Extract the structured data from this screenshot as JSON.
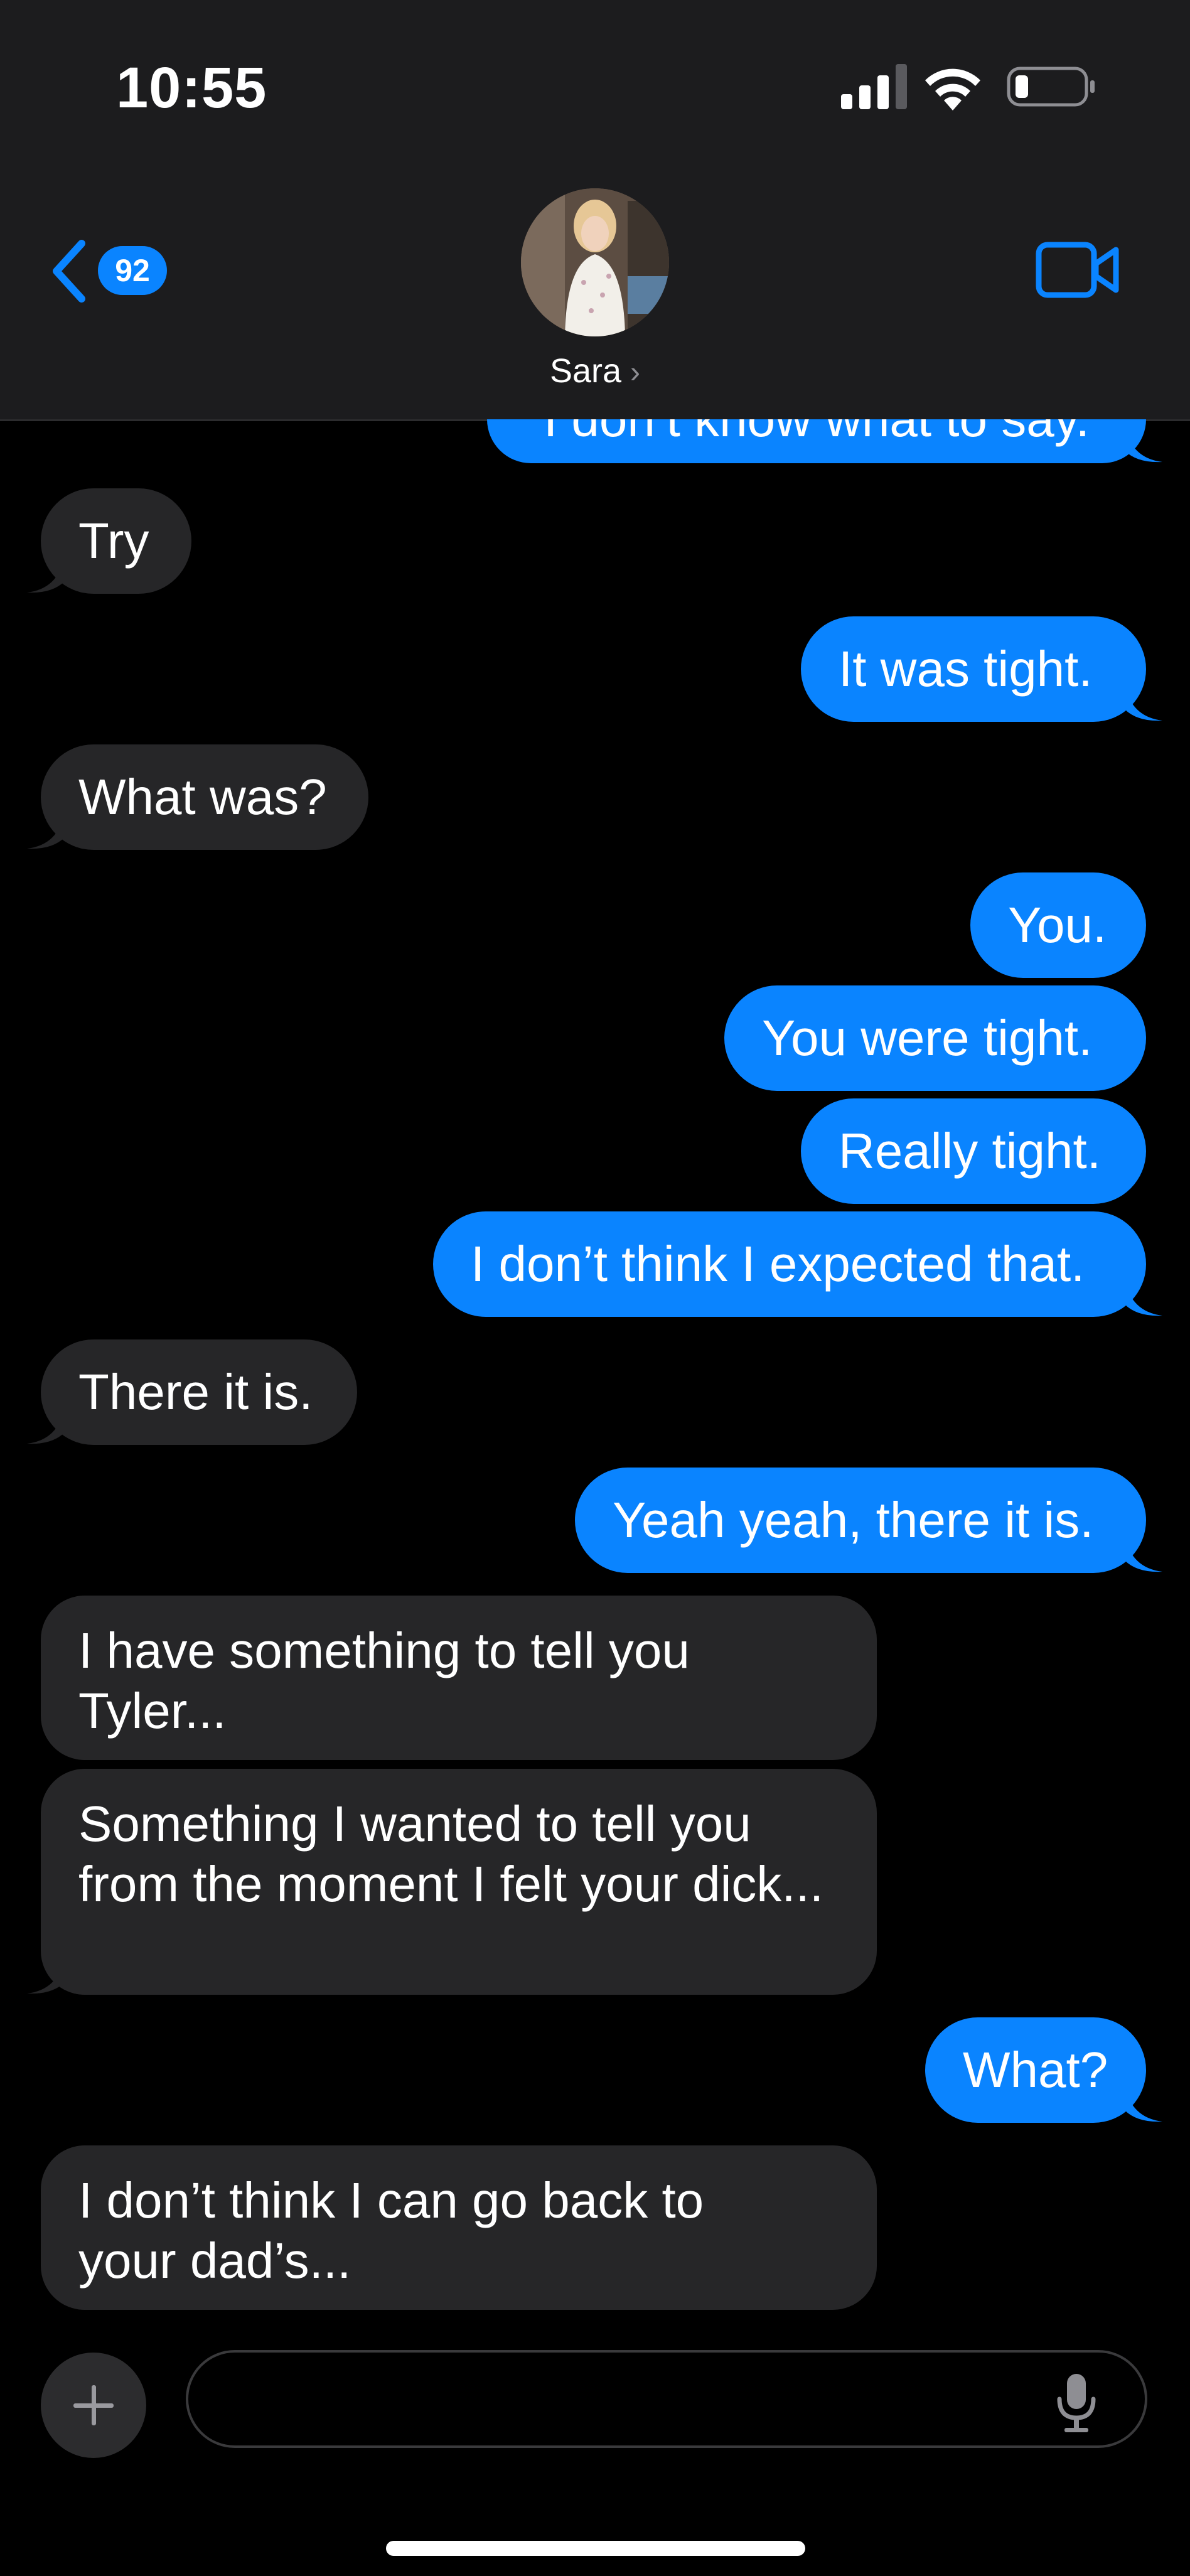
{
  "status": {
    "time": "10:55"
  },
  "header": {
    "back_count": "92",
    "contact_name": "Sara",
    "contact_chevron": "›"
  },
  "messages": [
    {
      "side": "out",
      "text": "I don’t know what to say."
    },
    {
      "side": "in",
      "text": "Try"
    },
    {
      "side": "out",
      "text": "It was tight."
    },
    {
      "side": "in",
      "text": "What was?"
    },
    {
      "side": "out",
      "text": "You."
    },
    {
      "side": "out",
      "text": "You were tight."
    },
    {
      "side": "out",
      "text": "Really tight."
    },
    {
      "side": "out",
      "text": "I don’t think I expected that."
    },
    {
      "side": "in",
      "text": "There it is."
    },
    {
      "side": "out",
      "text": "Yeah yeah, there it is."
    },
    {
      "side": "in",
      "text": "I have something to tell you Tyler..."
    },
    {
      "side": "in",
      "text": "Something I wanted to tell you from the moment I felt your dick..."
    },
    {
      "side": "out",
      "text": "What?"
    },
    {
      "side": "in",
      "text": "I don’t think I can go back to your dad’s..."
    }
  ],
  "composer": {
    "placeholder": ""
  },
  "icons": {
    "back": "chevron-left-icon",
    "video": "video-camera-icon",
    "plus": "plus-icon",
    "mic": "microphone-icon",
    "signal": "cellular-signal-icon",
    "wifi": "wifi-icon",
    "battery": "battery-icon"
  },
  "colors": {
    "outgoing": "#0a84ff",
    "incoming": "#262628",
    "header": "#1c1c1e",
    "background": "#000000"
  }
}
